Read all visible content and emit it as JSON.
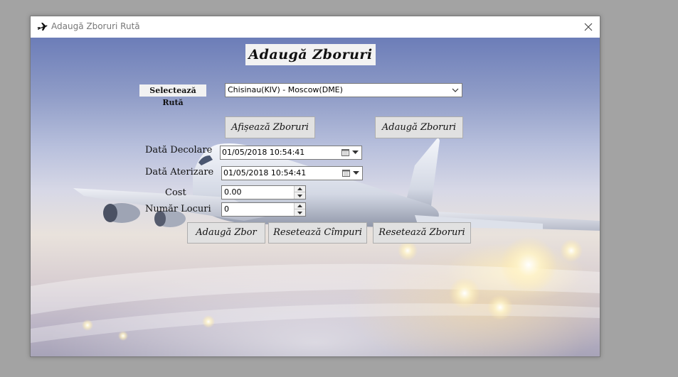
{
  "window": {
    "title": "Adaugă Zboruri Rută",
    "app_icon": "airplane-icon",
    "close_icon": "close-icon"
  },
  "form": {
    "heading": "Adaugă Zboruri",
    "route": {
      "label": "Selectează Rută",
      "value": "Chisinau(KIV) - Moscow(DME)"
    },
    "buttons": {
      "show_flights": "Afișează Zboruri",
      "add_flights": "Adaugă Zboruri",
      "add_flight": "Adaugă Zbor",
      "reset_fields": "Resetează Cîmpuri",
      "reset_flights": "Resetează Zboruri"
    },
    "departure": {
      "label": "Dată Decolare",
      "value": "01/05/2018 10:54:41"
    },
    "arrival": {
      "label": "Dată Aterizare",
      "value": "01/05/2018 10:54:41"
    },
    "cost": {
      "label": "Cost",
      "value": "0.00"
    },
    "seats": {
      "label": "Număr Locuri",
      "value": "0"
    }
  },
  "colors": {
    "desktop": "#a3a3a3",
    "button_face": "#e1e1e1",
    "label_back": "#f2f2f2"
  }
}
